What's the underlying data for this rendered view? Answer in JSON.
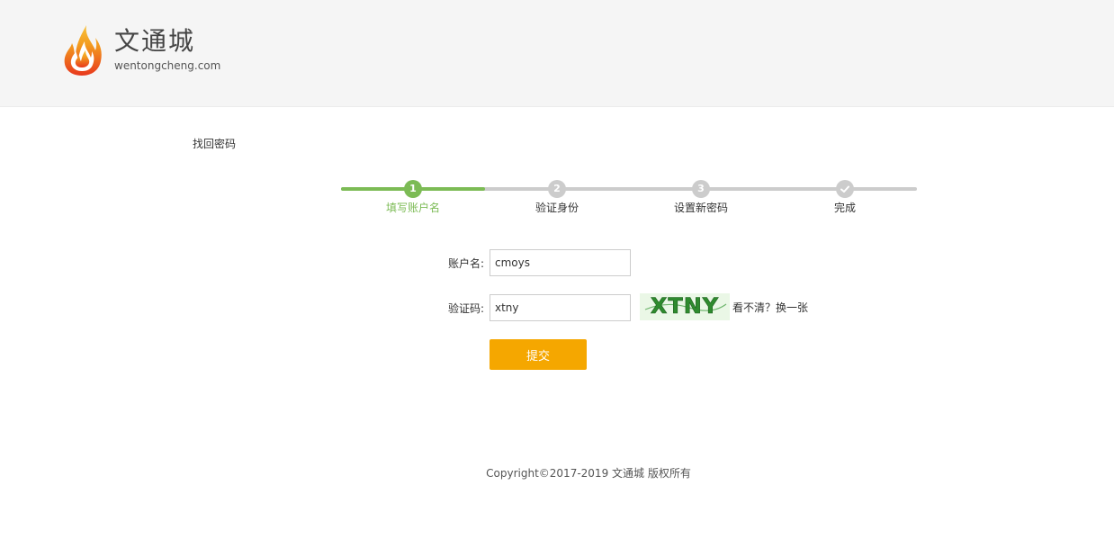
{
  "header": {
    "logo_title": "文通城",
    "logo_domain": "wentongcheng.com",
    "logo_icon": "flame-icon"
  },
  "page": {
    "title": "找回密码"
  },
  "steps": [
    {
      "number": "1",
      "label": "填写账户名",
      "state": "active"
    },
    {
      "number": "2",
      "label": "验证身份",
      "state": "pending"
    },
    {
      "number": "3",
      "label": "设置新密码",
      "state": "pending"
    },
    {
      "number": "check-icon",
      "label": "完成",
      "state": "pending"
    }
  ],
  "form": {
    "account_label": "账户名:",
    "account_value": "cmoys",
    "captcha_label": "验证码:",
    "captcha_value": "xtny",
    "captcha_image_text": "XTNY",
    "captcha_refresh": "看不清？换一张",
    "submit_label": "提交"
  },
  "footer": {
    "copyright": "Copyright©2017-2019  文通城 版权所有"
  },
  "colors": {
    "accent_green": "#7cbb55",
    "submit_orange": "#f5a700",
    "header_bg": "#f5f5f5",
    "inactive_gray": "#cccccc"
  }
}
